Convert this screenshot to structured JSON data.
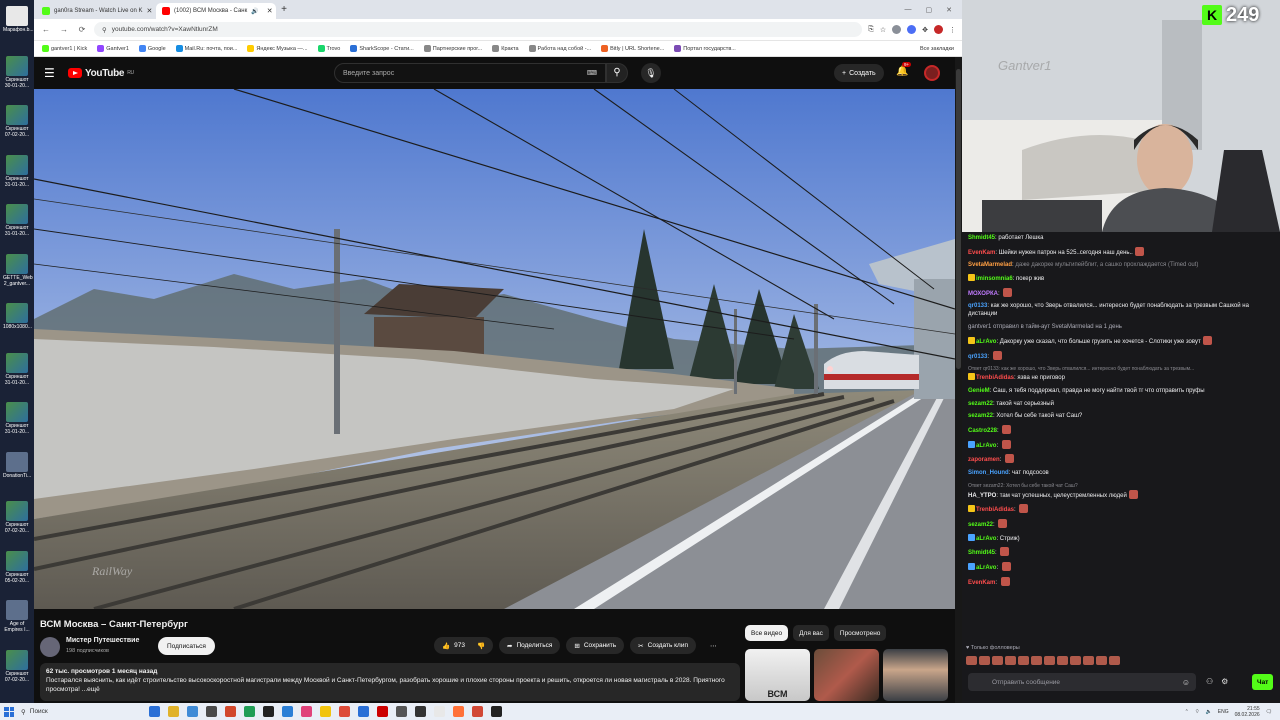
{
  "desktop": {
    "icons": [
      {
        "label": "Марафон.b...",
        "icon": "document-icon"
      },
      {
        "label": "Скриншот 30-01-20...",
        "icon": "image-icon"
      },
      {
        "label": "Скриншот 07-02-20...",
        "icon": "image-icon"
      },
      {
        "label": "Скриншот 31-01-20...",
        "icon": "image-icon"
      },
      {
        "label": "Скриншот 31-01-20...",
        "icon": "image-icon"
      },
      {
        "label": "GETTE_Web 2_gantver...",
        "icon": "image-icon"
      },
      {
        "label": "1080x1080...",
        "icon": "image-icon"
      },
      {
        "label": "Скриншот 31-01-20...",
        "icon": "image-icon"
      },
      {
        "label": "Скриншот 31-01-20...",
        "icon": "image-icon"
      },
      {
        "label": "DonationTi...",
        "icon": "app-icon"
      },
      {
        "label": "Скриншот 07-02-20...",
        "icon": "image-icon"
      },
      {
        "label": "Скриншот 05-02-20...",
        "icon": "image-icon"
      },
      {
        "label": "Age of Empires I...",
        "icon": "app-icon"
      },
      {
        "label": "Скриншот 07-02-20...",
        "icon": "image-icon"
      }
    ]
  },
  "browser": {
    "tabs": [
      {
        "title": "gan0ra Stream - Watch Live on K",
        "active": false,
        "color": "#53fc18"
      },
      {
        "title": "(1002) ВСМ Москва - Санк",
        "active": true,
        "color": "#ff0000"
      }
    ],
    "url": "youtube.com/watch?v=XawNtlunrZM",
    "bookmarks": [
      {
        "label": "gantver1 | Kick",
        "color": "#53fc18"
      },
      {
        "label": "Gantver1",
        "color": "#9146ff"
      },
      {
        "label": "Google",
        "color": "#4285f4"
      },
      {
        "label": "Mail.Ru: почта, пои...",
        "color": "#168de2"
      },
      {
        "label": "Яндекс Музыка —...",
        "color": "#ffcc00"
      },
      {
        "label": "Trovo",
        "color": "#19d66b"
      },
      {
        "label": "SharkScope - Стати...",
        "color": "#2a6fd6"
      },
      {
        "label": "Партнерские прог...",
        "color": "#888888"
      },
      {
        "label": "Кракта",
        "color": "#888888"
      },
      {
        "label": "Работа над собой -...",
        "color": "#888888"
      },
      {
        "label": "Bitly | URL Shortene...",
        "color": "#ee6123"
      },
      {
        "label": "Портал государств...",
        "color": "#7b4bb4"
      }
    ],
    "all_bookmarks": "Все закладки"
  },
  "youtube": {
    "logo": "YouTube",
    "region": "RU",
    "search_placeholder": "Введите запрос",
    "create_label": "Создать",
    "notifications": "9+",
    "video_title": "ВСМ Москва – Санкт-Петербург",
    "watermark": "RailWay",
    "channel_name": "Мистер Путешествие",
    "channel_subs": "198 подписчиков",
    "subscribe_label": "Подписаться",
    "likes": "973",
    "share_label": "Поделиться",
    "save_label": "Сохранить",
    "clip_label": "Создать клип",
    "views_line": "62 тыс. просмотров  1 месяц назад",
    "description": "Постарался выяснить, как идёт строительство высокоскоростной магистрали между Москвой и Санкт-Петербургом, разобрать хорошие и плохие стороны проекта и решить, откроется ли новая магистраль в 2028. Приятного просмотра! ...ещё",
    "chips": [
      {
        "label": "Все видео",
        "active": true
      },
      {
        "label": "Для вас",
        "active": false
      },
      {
        "label": "Просмотрено",
        "active": false
      }
    ],
    "thumb_label": "ВСМ"
  },
  "stream": {
    "watermark": "Gantver1",
    "viewers": "249",
    "chat": [
      {
        "user": "Shmidt45",
        "color": "#53fc18",
        "text": "работает Лешка"
      },
      {
        "user": "EvenKam",
        "color": "#ff4d4d",
        "text": "Шейки нужен патрон на 525..сегодня наш день..",
        "emote": true
      },
      {
        "user": "SvetaMarmelad",
        "color": "#ff9f43",
        "text": "даже дакорке мультипейблит, а сашко прохлаждается (Timed out)",
        "strike": true
      },
      {
        "user": "iminsomnia6",
        "color": "#53fc18",
        "text": "покер жив",
        "badge": "#f5c518"
      },
      {
        "user": "МОХОРКА",
        "color": "#c17bff",
        "text": "",
        "emote": true
      },
      {
        "user": "qr0133",
        "color": "#4aa3ff",
        "text": "как же хорошо, что Зверь отвалился... интересно будет понаблюдать за трезвым Сашкой на дистанции"
      },
      {
        "system": "gantver1 отправил в тайм-аут SvetaMarmelad на 1 день"
      },
      {
        "user": "aLrAvo",
        "color": "#53fc18",
        "text": "Дакорку уже сказал, что больше грузить не хочется - Слотики уже зовут",
        "badge": "#f5c518",
        "emote": true
      },
      {
        "user": "qr0133",
        "color": "#4aa3ff",
        "text": "",
        "emote": true
      },
      {
        "reply": "Ответ qr0133: как же хорошо, что Зверь отвалился... интересно будет понаблюдать за трезвым...",
        "user": "TrenbiAdidas",
        "color": "#ff4d4d",
        "text": "язва не приговор",
        "badge": "#f5c518"
      },
      {
        "user": "GenieM",
        "color": "#53fc18",
        "text": "Саш, я тебя поддержал, правда не могу найти твой тг что отправить пруфы"
      },
      {
        "user": "sezam22",
        "color": "#53fc18",
        "text": "такой чат серьезный"
      },
      {
        "user": "sezam22",
        "color": "#53fc18",
        "text": "Хотел бы себе такой чат Саш?"
      },
      {
        "user": "Castro228",
        "color": "#53fc18",
        "text": "",
        "emote": true
      },
      {
        "user": "aLrAvo",
        "color": "#53fc18",
        "text": "",
        "badge": "#4aa3ff",
        "emote": true
      },
      {
        "user": "zaporamen",
        "color": "#ff4d4d",
        "text": "",
        "emote": true
      },
      {
        "user": "Simon_Hound",
        "color": "#4aa3ff",
        "text": "чат подсосов"
      },
      {
        "reply": "Ответ sezam22: Хотел бы себе такой чат Саш?",
        "user": "HA_YTPO",
        "color": "#efeff1",
        "text": "там чат успешных, целеустремленных людей",
        "emote": true
      },
      {
        "user": "TrenbiAdidas",
        "color": "#ff4d4d",
        "text": "",
        "badge": "#f5c518",
        "emote": true
      },
      {
        "user": "sezam22",
        "color": "#53fc18",
        "text": "",
        "emote": true
      },
      {
        "user": "aLrAvo",
        "color": "#53fc18",
        "text": "Стриж)",
        "badge": "#4aa3ff"
      },
      {
        "user": "Shmidt45",
        "color": "#53fc18",
        "text": "",
        "emote": true
      },
      {
        "user": "aLrAvo",
        "color": "#53fc18",
        "text": "",
        "badge": "#4aa3ff",
        "emote": true
      },
      {
        "user": "EvenKam",
        "color": "#ff4d4d",
        "text": "",
        "emote": true
      }
    ],
    "followers_only": "Только фолловеры",
    "input_placeholder": "Отправить сообщение",
    "send_label": "Чат"
  },
  "taskbar": {
    "search_label": "Поиск",
    "lang": "ENG",
    "time": "21:55",
    "date": "08.02.2026",
    "apps": [
      "#2a6fd6",
      "#e0b22a",
      "#3f8bd6",
      "#4a4a4a",
      "#d1472b",
      "#1f9d55",
      "#222222",
      "#2b7fd6",
      "#e0427a",
      "#f1c40f",
      "#dd4b39",
      "#2a6fd6",
      "#cc0000",
      "#555555",
      "#333333",
      "#e8e8e8",
      "#ff7139",
      "#d14836",
      "#222222"
    ]
  }
}
